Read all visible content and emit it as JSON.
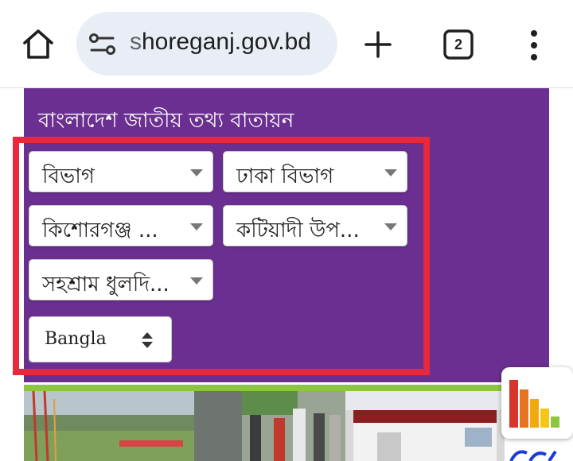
{
  "browser": {
    "url_host": "shoreganj.gov.bd",
    "url_prefix_faded": "s",
    "tab_count": "2",
    "icons": [
      "home-icon",
      "site-info-icon",
      "plus-icon",
      "tab-switcher-icon",
      "more-vert-icon"
    ]
  },
  "portal": {
    "title": "বাংলাদেশ জাতীয় তথ্য বাতায়ন"
  },
  "selectors": {
    "division": "বিভাগ",
    "division_name": "ঢাকা বিভাগ",
    "district": "কিশোরগঞ্জ ...",
    "upazila": "কটিয়াদী উপ...",
    "union": "সহশ্রাম ধুলদি..."
  },
  "language": {
    "selected": "Bangla"
  },
  "colors": {
    "panel": "#6a2f90",
    "highlight": "#e8283c",
    "strip": "#8cc63f",
    "url_pill": "#e9eef6"
  }
}
